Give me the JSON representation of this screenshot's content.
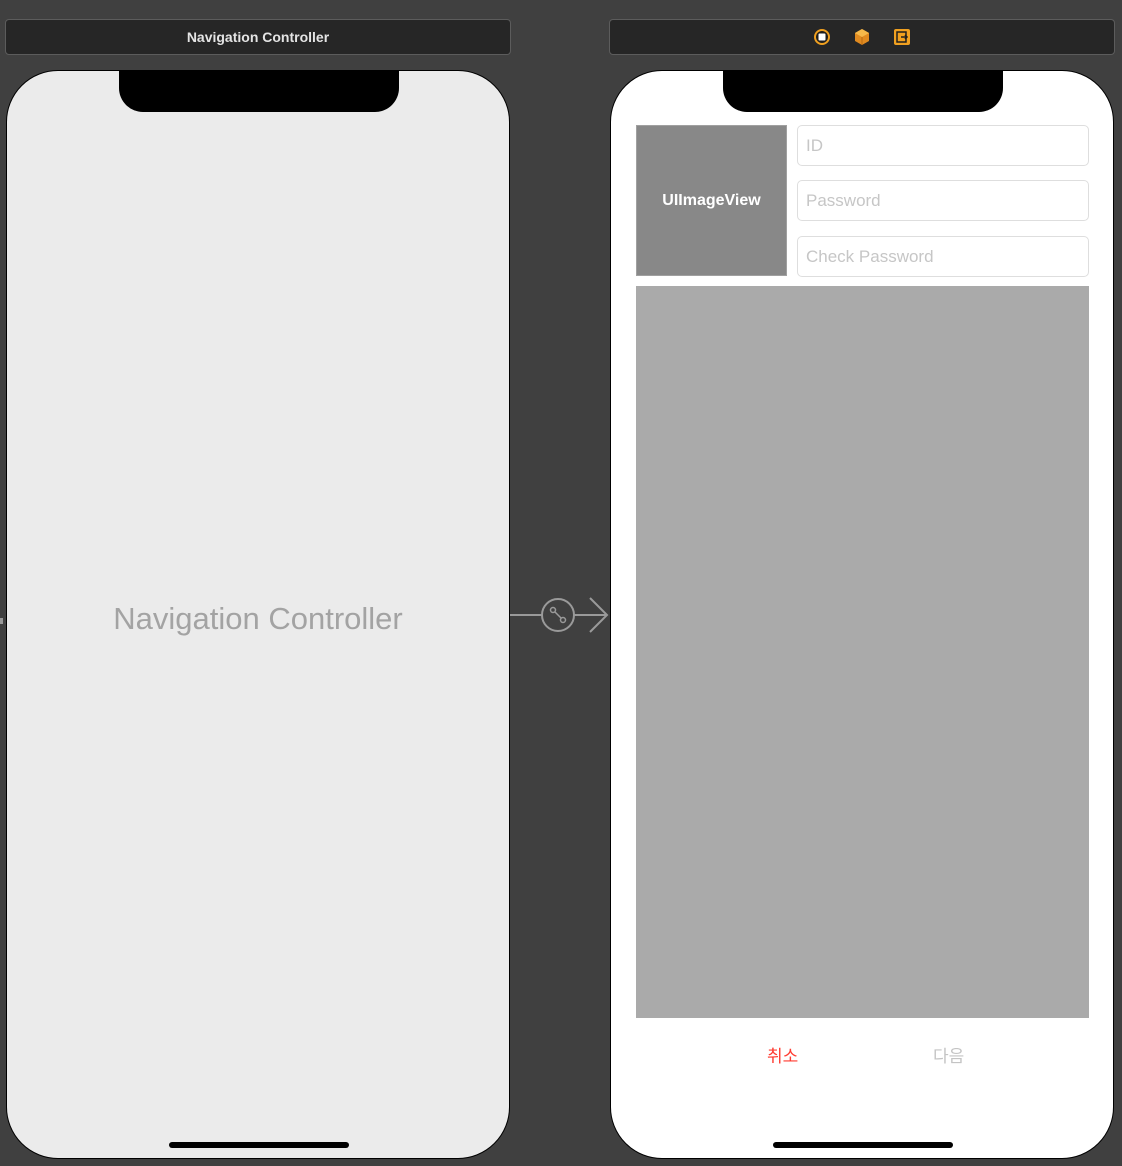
{
  "left_scene": {
    "title": "Navigation Controller",
    "placeholder_label": "Navigation Controller"
  },
  "right_scene": {
    "bar_icons": [
      "view-controller-icon",
      "first-responder-icon",
      "exit-icon"
    ],
    "image_view_label": "UIImageView",
    "fields": {
      "id_placeholder": "ID",
      "password_placeholder": "Password",
      "check_password_placeholder": "Check Password"
    },
    "buttons": {
      "cancel": "취소",
      "next": "다음"
    }
  },
  "colors": {
    "canvas": "#404040",
    "cancel_tint": "#ff3b30",
    "next_tint": "#c4c4c4",
    "icon_accent": "#f0a020"
  }
}
